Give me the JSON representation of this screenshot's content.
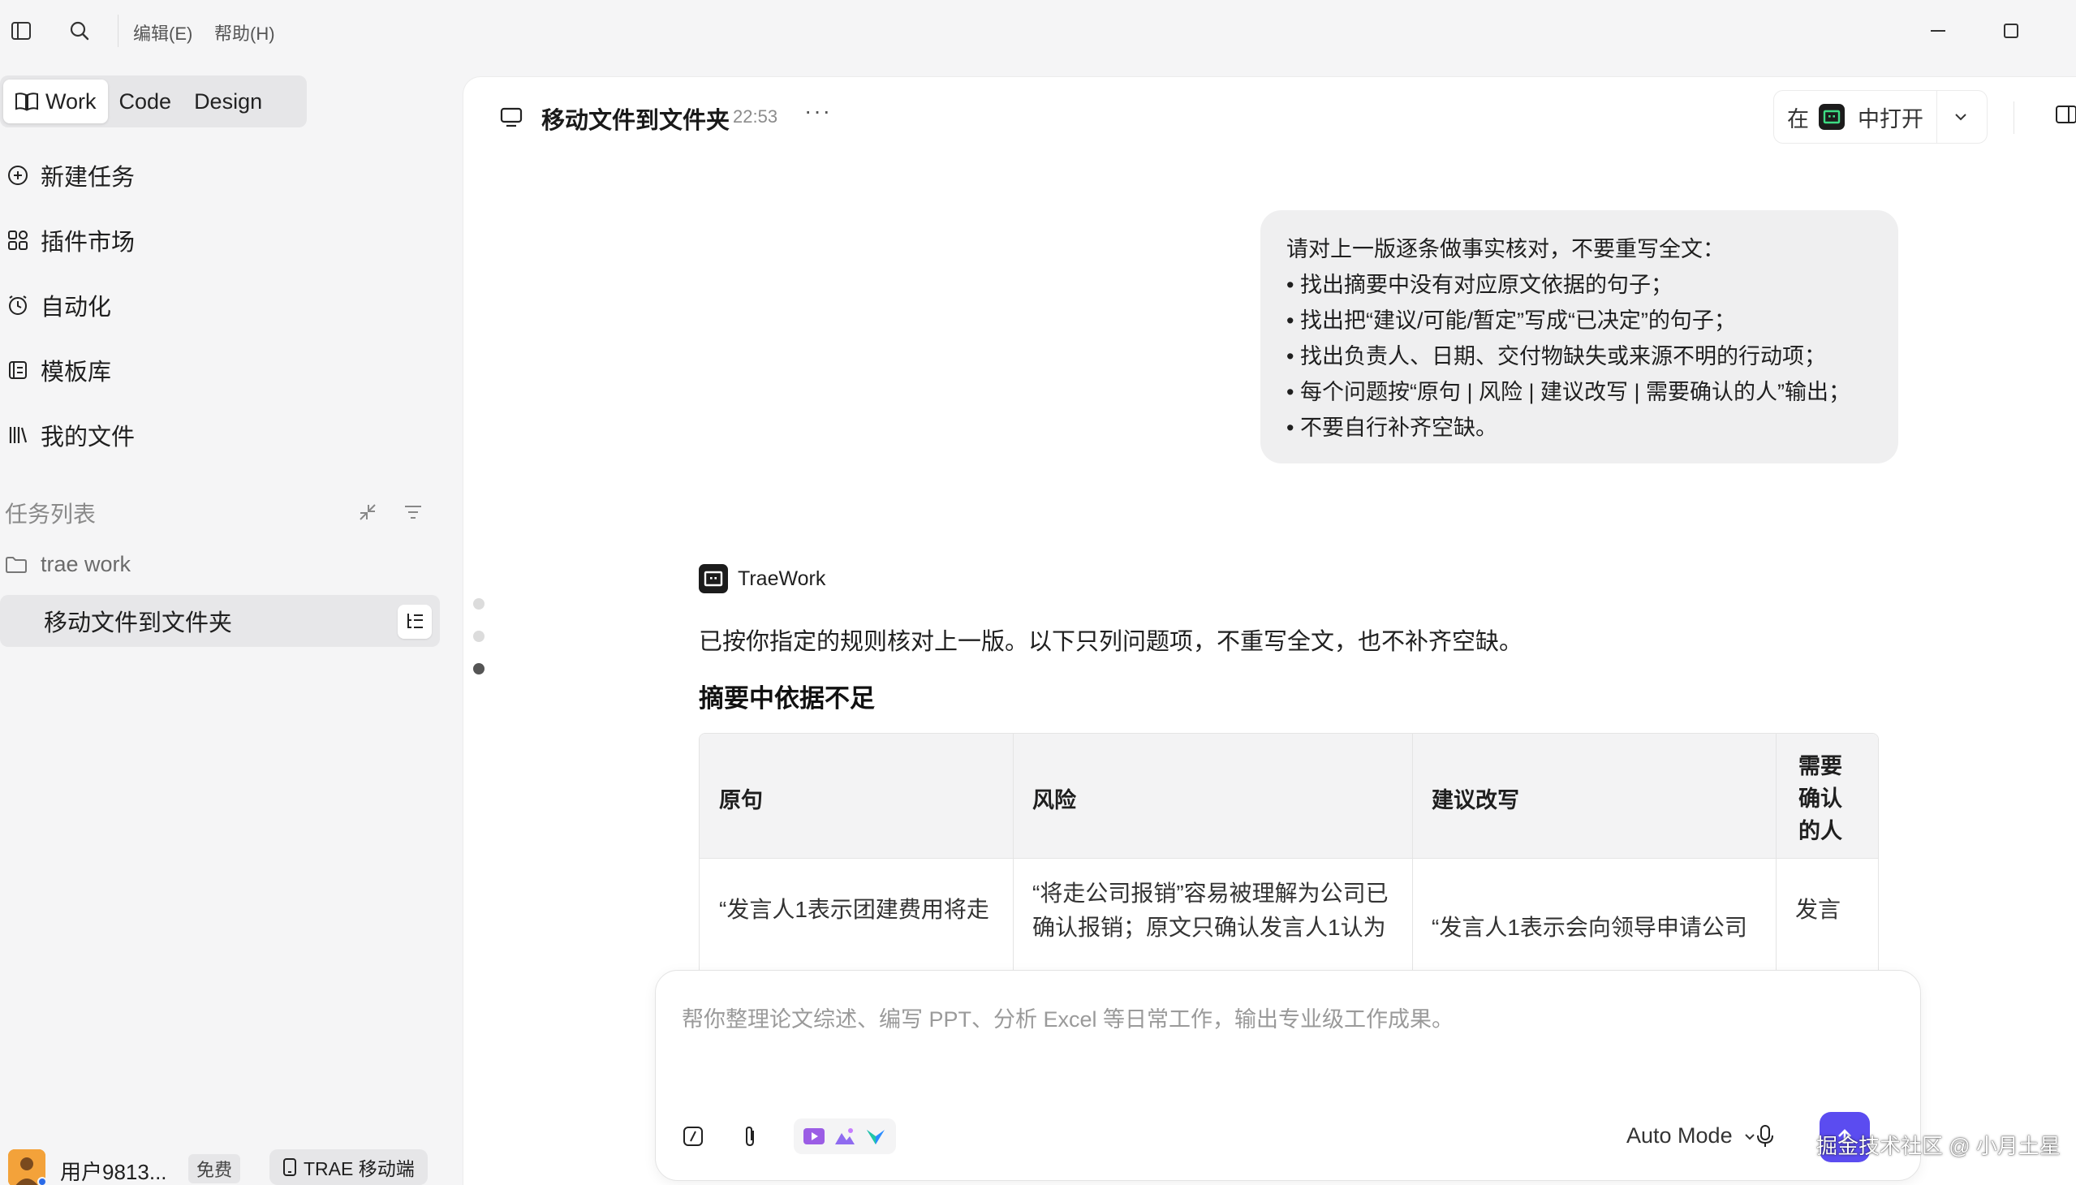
{
  "titlebar": {
    "menus": [
      "编辑(E)",
      "帮助(H)"
    ]
  },
  "modes": {
    "tabs": [
      {
        "label": "Work",
        "active": true
      },
      {
        "label": "Code",
        "active": false
      },
      {
        "label": "Design",
        "active": false
      }
    ]
  },
  "sidebar": {
    "nav": [
      {
        "label": "新建任务",
        "icon": "plus-circle-icon"
      },
      {
        "label": "插件市场",
        "icon": "plugin-grid-icon"
      },
      {
        "label": "自动化",
        "icon": "clock-icon"
      },
      {
        "label": "模板库",
        "icon": "template-icon"
      },
      {
        "label": "我的文件",
        "icon": "library-icon"
      }
    ],
    "task_list_title": "任务列表",
    "folder_name": "trae work",
    "active_task": "移动文件到文件夹"
  },
  "user": {
    "name": "用户9813...",
    "plan": "免费",
    "mobile_label": "TRAE 移动端"
  },
  "main": {
    "title": "移动文件到文件夹",
    "time": "22:53",
    "more": "···",
    "open_in_prefix": "在",
    "open_in_suffix": "中打开"
  },
  "user_message": {
    "lines": [
      "请对上一版逐条做事实核对，不要重写全文：",
      "• 找出摘要中没有对应原文依据的句子；",
      "• 找出把“建议/可能/暂定”写成“已决定”的句子；",
      "• 找出负责人、日期、交付物缺失或来源不明的行动项；",
      "• 每个问题按“原句 | 风险 | 建议改写 | 需要确认的人”输出；",
      "• 不要自行补齐空缺。"
    ]
  },
  "assistant": {
    "name": "TraeWork",
    "intro": "已按你指定的规则核对上一版。以下只列问题项，不重写全文，也不补齐空缺。",
    "heading": "摘要中依据不足",
    "table": {
      "headers": [
        "原句",
        "风险",
        "建议改写",
        "需要确认的人"
      ],
      "header_stack": [
        "需要",
        "确认",
        "的人"
      ],
      "row1": {
        "c1": "“发言人1表示团建费用将走",
        "c2a": "“将走公司报销”容易被理解为公司已",
        "c2b": "确认报销；原文只确认发言人1认为",
        "c3": "“发言人1表示会向领导申请公司",
        "c4": "发言"
      }
    }
  },
  "composer": {
    "placeholder": "帮你整理论文综述、编写 PPT、分析 Excel 等日常工作，输出专业级工作成果。",
    "mode": "Auto Mode"
  },
  "watermark": "掘金技术社区 @ 小月土星"
}
